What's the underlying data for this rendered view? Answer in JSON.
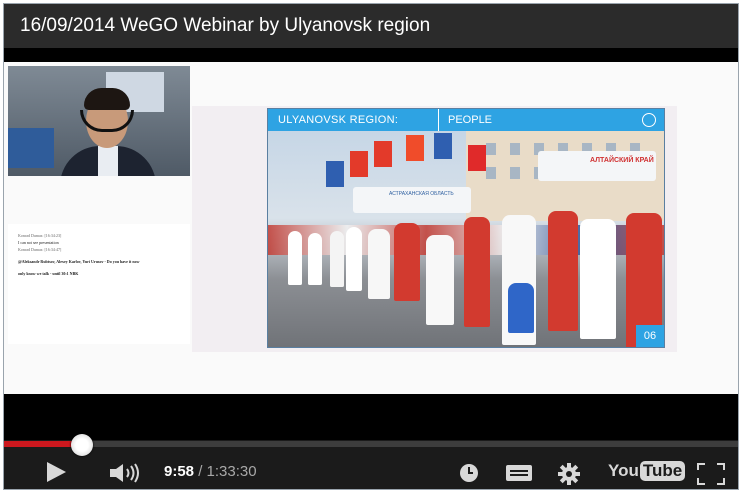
{
  "window": {
    "title": "16/09/2014 WeGO Webinar by Ulyanovsk region"
  },
  "chat": {
    "lines": [
      "Konrad Dumas: [16:34:23]",
      "I can not see presentation",
      "Konrad Dumas: [16:34:47]",
      "@Aleksandr Rubtsov, Alexey Karlov, Yuri Urusov - Do you have it now",
      "only know we talk - until 30:1 NBK"
    ]
  },
  "slide": {
    "region_label": "ULYANOVSK REGION:",
    "section_label": "PEOPLE",
    "number": "06",
    "sign_left": "АСТРАХАНСКАЯ ОБЛАСТЬ",
    "sign_right": "АЛТАЙСКИЙ КРАЙ"
  },
  "player": {
    "current_time": "9:58",
    "separator": "/",
    "duration": "1:33:30",
    "progress_fraction": 0.1066,
    "buttons": {
      "play": "play-icon",
      "volume": "volume-icon",
      "watch_later": "clock-icon",
      "captions": "captions-icon",
      "settings": "gear-icon",
      "logo": "youtube-logo",
      "fullscreen": "fullscreen-icon"
    },
    "logo_text_you": "You",
    "logo_text_tube": "Tube"
  },
  "colors": {
    "progress": "#cc181e",
    "slide_header": "#2ea3e3"
  }
}
